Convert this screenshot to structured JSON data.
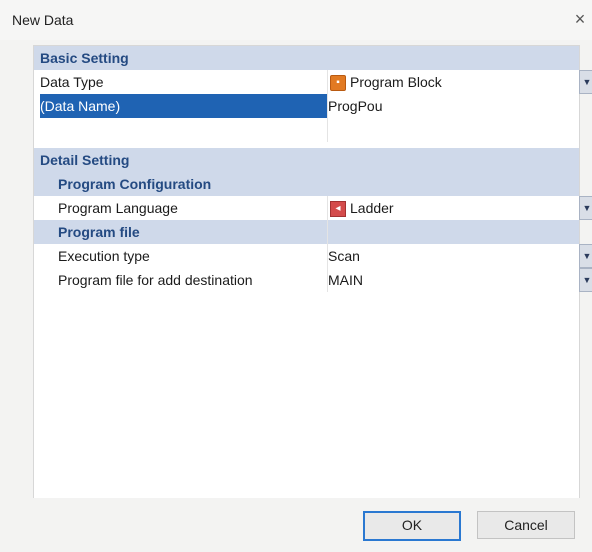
{
  "dialog": {
    "title": "New Data",
    "close_glyph": "×"
  },
  "basic_setting": {
    "label": "Basic Setting",
    "data_type": {
      "label": "Data Type",
      "value": "Program Block",
      "icon": "program-block-icon"
    },
    "data_name": {
      "label": "(Data Name)",
      "value": "ProgPou",
      "selected": true
    }
  },
  "detail_setting": {
    "label": "Detail Setting",
    "program_configuration": {
      "label": "Program Configuration",
      "program_language": {
        "label": "Program Language",
        "value": "Ladder",
        "icon": "ladder-icon"
      }
    },
    "program_file": {
      "label": "Program file",
      "execution_type": {
        "label": "Execution type",
        "value": "Scan"
      },
      "add_destination": {
        "label": "Program file for add destination",
        "value": "MAIN"
      }
    }
  },
  "buttons": {
    "ok": "OK",
    "cancel": "Cancel"
  },
  "colors": {
    "category_bg": "#cfd9ea",
    "category_text": "#244a82",
    "selection": "#1f63b3",
    "ok_border": "#2a78d1"
  }
}
